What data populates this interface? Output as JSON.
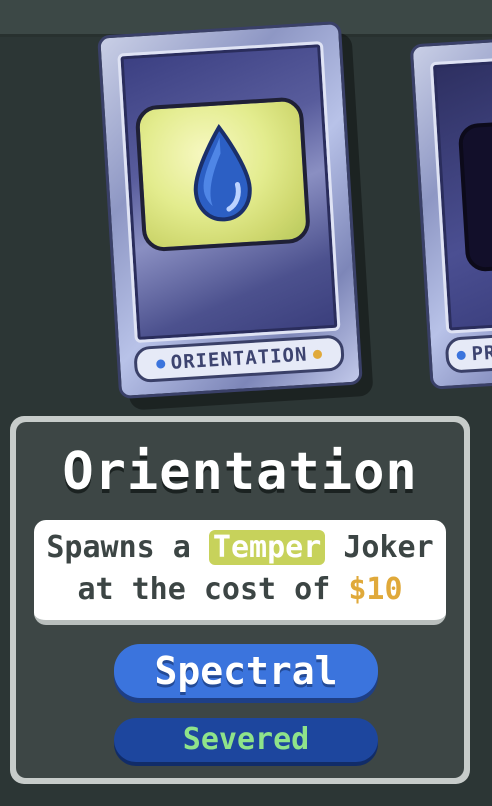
{
  "card": {
    "name_label": "ORIENTATION",
    "icon": "water-drop-icon",
    "accent_colors": {
      "label_dot": "#3b74dd",
      "label_dot_right": "#e0a93a"
    }
  },
  "side_card": {
    "name_label_partial": "PR"
  },
  "info": {
    "title": "Orientation",
    "description": {
      "line1_prefix": "Spawns a ",
      "line1_highlight": "Temper",
      "line1_suffix": " Joker",
      "line2_prefix": "at the cost of ",
      "line2_money": "$10"
    },
    "type_label": "Spectral",
    "sub_label": "Severed",
    "colors": {
      "temper_highlight": "#c7d25b",
      "money": "#e0a93a",
      "type_button": "#3b74dd",
      "sub_badge": "#1d469e",
      "sub_text": "#8fe38a"
    }
  }
}
